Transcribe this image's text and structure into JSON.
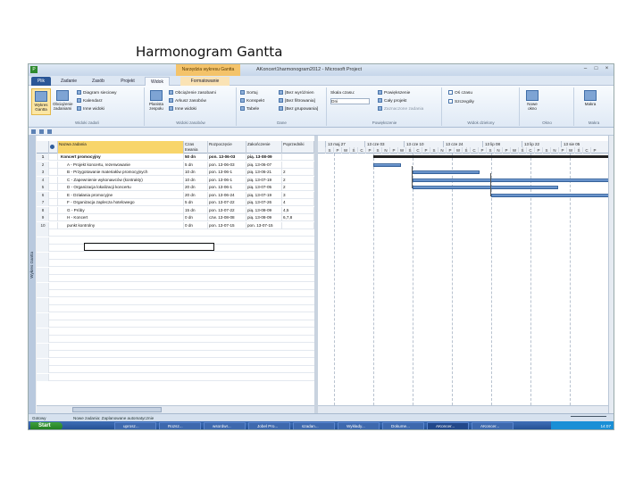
{
  "slide_title": "Harmonogram Gantta",
  "window": {
    "app_icon": "P",
    "context_header": "Narzędzia wykresu Gantta",
    "title": "AKoncert1harmonogram2012 - Microsoft Project",
    "controls": [
      "–",
      "□",
      "×"
    ]
  },
  "ribbon_tabs": [
    "Plik",
    "Zadanie",
    "Zasób",
    "Projekt",
    "Widok",
    "Formatowanie"
  ],
  "ribbon": {
    "task_views": {
      "gantt_label": "Wykres Gantta",
      "calendar_label": "Obciążenie zadaniami",
      "items": [
        "Diagram sieciowy",
        "Kalendarz",
        "Inne widoki"
      ],
      "group_label": "Widoki zadań"
    },
    "resource_views": {
      "big_label": "Planista zespołu",
      "items": [
        "Obciążenie zasobami",
        "Arkusz zasobów",
        "Inne widoki"
      ],
      "group_label": "Widoki zasobów"
    },
    "data": {
      "items": [
        "Sortuj",
        "Konspekt",
        "Tabele"
      ],
      "items2": [
        "[Bez wyróżnien",
        "[Bez filtrowania]",
        "[Bez grupowania]"
      ],
      "group_label": "Dane"
    },
    "zoom": {
      "items": [
        "Skala czasu:",
        "Dni"
      ],
      "items2": [
        "Powiększenie",
        "Cały projekt",
        "Zaznaczone zadania"
      ],
      "group_label": "Powiększenie"
    },
    "split_view": {
      "items": [
        "Oś czasu",
        "Szczegóły"
      ],
      "group_label": "Widok dzielony"
    },
    "window": {
      "big_label": "Nowe okno",
      "group_label": "Okno"
    },
    "macros": {
      "big_label": "Makra",
      "group_label": "Makra"
    }
  },
  "sidebar_label": "Wykres Gantta",
  "grid": {
    "headers": [
      "",
      "Tryb",
      "Nazwa zadania",
      "Czas trwania",
      "Rozpoczęcie",
      "Zakończenie",
      "Poprzedniki"
    ],
    "rows": [
      {
        "num": "1",
        "name": "Koncert promocyjny",
        "dur": "50 dn",
        "start": "pon. 13-06-03",
        "end": "pią. 13-08-09",
        "pred": "",
        "bold": true
      },
      {
        "num": "2",
        "name": "A - Projekt koncertu, rezerwowanie",
        "dur": "5 dn",
        "start": "pon. 13-06-03",
        "end": "pią. 13-06-07",
        "pred": ""
      },
      {
        "num": "3",
        "name": "B - Przygotowanie materiałów promocyjnych",
        "dur": "10 dn",
        "start": "pon. 13-06-1",
        "end": "pią. 13-06-21",
        "pred": "2"
      },
      {
        "num": "4",
        "name": "C - Zapewnienie wykonawców (kontrakty)",
        "dur": "10 dn",
        "start": "pon. 13-06-1",
        "end": "pią. 13-07-19",
        "pred": "2"
      },
      {
        "num": "5",
        "name": "D - Organizacja lokalizacji koncertu",
        "dur": "20 dn",
        "start": "pon. 13-06-1",
        "end": "pią. 13-07-05",
        "pred": "2"
      },
      {
        "num": "6",
        "name": "E - Działania promocyjne",
        "dur": "20 dn",
        "start": "pon. 13-06-24",
        "end": "pią. 13-07-19",
        "pred": "3"
      },
      {
        "num": "7",
        "name": "F - Organizacja zaplecza hotelowego",
        "dur": "5 dn",
        "start": "pon. 13-07-22",
        "end": "pią. 13-07-26",
        "pred": "4"
      },
      {
        "num": "8",
        "name": "G - Próby",
        "dur": "15 dn",
        "start": "pon. 13-07-22",
        "end": "pią. 13-08-09",
        "pred": "4,5"
      },
      {
        "num": "9",
        "name": "H - Koncert",
        "dur": "0 dn",
        "start": "czw. 13-08-08",
        "end": "pią. 13-08-09",
        "pred": "6,7,8"
      },
      {
        "num": "10",
        "name": "punkt kontrolny",
        "dur": "0 dn",
        "start": "pon. 13-07-15",
        "end": "pon. 13-07-15",
        "pred": ""
      }
    ]
  },
  "timescale": {
    "weeks": [
      "13 maj 27",
      "13 cze 03",
      "13 cze 10",
      "13 cze 24",
      "13 lip 08",
      "13 lip 22",
      "13 sie 05"
    ],
    "days": [
      "S",
      "P",
      "W",
      "Ś",
      "C",
      "P",
      "S",
      "N",
      "P",
      "W",
      "Ś",
      "C",
      "P",
      "S",
      "N",
      "P",
      "W",
      "Ś",
      "C",
      "P",
      "S",
      "N",
      "P",
      "W",
      "Ś",
      "C",
      "P",
      "S",
      "N",
      "P",
      "W",
      "Ś",
      "C",
      "P"
    ]
  },
  "milestone_label": "07-15",
  "status": {
    "left": "Gotowy",
    "mode": "Nowe zadania: Zaplanowane automatycznie"
  },
  "taskbar": {
    "start": "Start",
    "items": [
      "uprosz...",
      "Rozsz...",
      "wsordwr...",
      "Jobel Pro...",
      "szadan...",
      "Wykłady...",
      "Dokume...",
      "AKoncer...",
      "AKoncer..."
    ],
    "clock": "14:07"
  },
  "colors": {
    "bar": "#4b79b8",
    "file_tab": "#2b5797",
    "context_tab": "#f4c36a",
    "taskbar": "#1f4a8d"
  }
}
